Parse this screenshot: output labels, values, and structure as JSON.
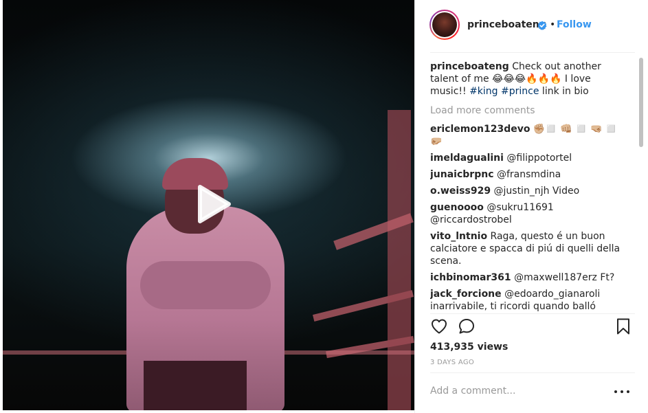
{
  "post": {
    "username": "princeboateng",
    "follow_label": "Follow",
    "dot": "•",
    "caption": {
      "user": "princeboateng",
      "text": " Check out another talent of me 😂😂😂🔥🔥🔥 I love music!! ",
      "hashtag_king": "#king",
      "hashtag_prince": "#prince",
      "tail": " link in bio"
    },
    "load_more": "Load more comments",
    "comments": [
      {
        "user": "ericlemon123devo",
        "text": " ✊🏼◻️ 👊🏼 ◻️ 🤜🏼 ◻️🤛🏼"
      },
      {
        "user": "imeldagualini",
        "text": " @filippotortel"
      },
      {
        "user": "junaicbrpnc",
        "text": " @fransmdina"
      },
      {
        "user": "o.weiss929",
        "text": " @justin_njh Video"
      },
      {
        "user": "guenoooo",
        "text": " @sukru11691 @riccardostrobel"
      },
      {
        "user": "vito_lntnio",
        "text": " Raga, questo é un buon calciatore e spacca di piú di quelli della scena."
      },
      {
        "user": "ichbinomar361",
        "text": " @maxwell187erz Ft?"
      },
      {
        "user": "jack_forcione",
        "text": " @edoardo_gianaroli inarrivabile, ti ricordi quando balló Michael Jackson alla festa scudetto?! 😍"
      }
    ],
    "views": "413,935 views",
    "time": "3 DAYS AGO",
    "comment_placeholder": "Add a comment..."
  },
  "colors": {
    "link_blue": "#3897f0",
    "hashtag": "#003569",
    "muted": "#999999",
    "text": "#262626"
  },
  "icons": [
    "play-icon",
    "verified-badge-icon",
    "heart-icon",
    "comment-bubble-icon",
    "bookmark-icon",
    "more-options-icon"
  ]
}
